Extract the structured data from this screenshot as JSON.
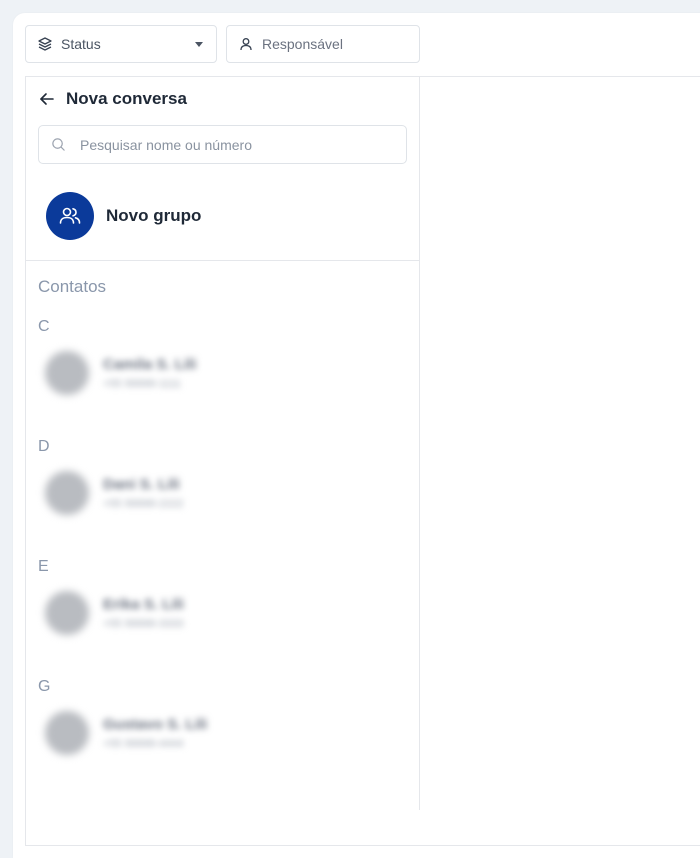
{
  "filters": {
    "status": {
      "label": "Status",
      "icon": "layers-icon"
    },
    "responsavel": {
      "placeholder": "Responsável",
      "icon": "user-icon"
    }
  },
  "new_chat": {
    "title": "Nova conversa",
    "search_placeholder": "Pesquisar nome ou número",
    "new_group_label": "Novo grupo",
    "contacts_heading": "Contatos"
  },
  "contact_groups": [
    {
      "letter": "C",
      "contacts": [
        {
          "name": "Camila S. Lili",
          "phone": "+55 99999-1111"
        }
      ]
    },
    {
      "letter": "D",
      "contacts": [
        {
          "name": "Dani S. Lili",
          "phone": "+55 99999-2222"
        }
      ]
    },
    {
      "letter": "E",
      "contacts": [
        {
          "name": "Erika S. Lili",
          "phone": "+55 99999-3333"
        }
      ]
    },
    {
      "letter": "G",
      "contacts": [
        {
          "name": "Gustavo S. Lili",
          "phone": "+55 99999-4444"
        }
      ]
    }
  ],
  "colors": {
    "accent": "#0b3a9a",
    "muted_text": "#8a97ab",
    "border": "#e5e7eb"
  }
}
